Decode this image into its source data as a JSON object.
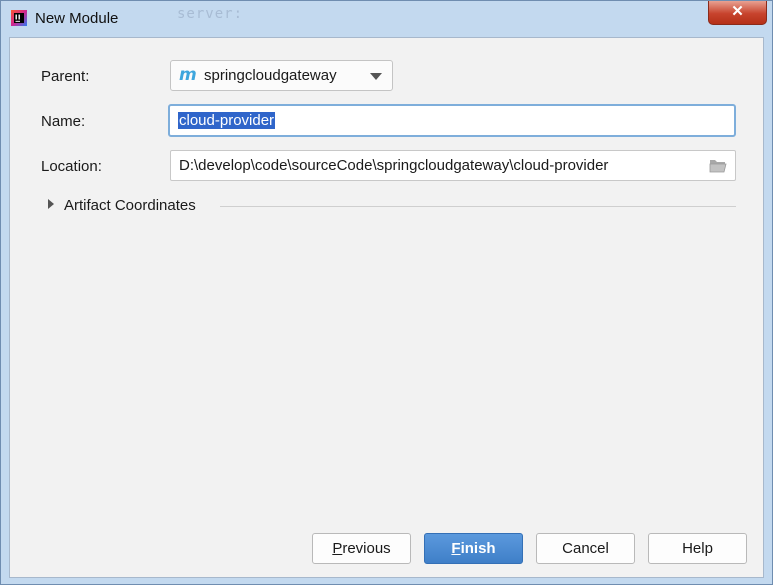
{
  "window": {
    "title": "New Module",
    "background_text": "server:",
    "close_label": "✕",
    "app_icon": "intellij-idea-icon"
  },
  "form": {
    "parent_label": "Parent:",
    "parent_value": "springcloudgateway",
    "parent_icon": "maven-m-icon",
    "parent_icon_glyph": "m",
    "name_label": "Name:",
    "name_value": "cloud-provider",
    "location_label": "Location:",
    "location_value": "D:\\develop\\code\\sourceCode\\springcloudgateway\\cloud-provider",
    "artifact_label": "Artifact Coordinates"
  },
  "buttons": {
    "previous_mnemonic": "P",
    "previous_rest": "revious",
    "finish_mnemonic": "F",
    "finish_rest": "inish",
    "cancel": "Cancel",
    "help": "Help"
  },
  "colors": {
    "primary_button": "#3f7fc8",
    "selection": "#2f65ca",
    "maven_icon": "#3ea6dd",
    "close_button": "#c7432d"
  }
}
